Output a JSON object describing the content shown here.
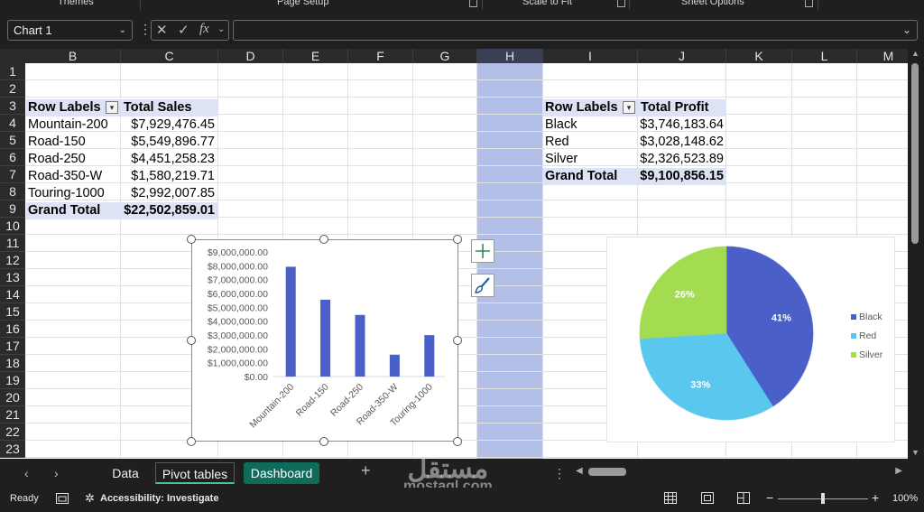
{
  "ribbon_groups": {
    "themes": "Themes",
    "page_setup": "Page Setup",
    "scale_to_fit": "Scale to Fit",
    "sheet_options": "Sheet Options"
  },
  "formula_bar": {
    "name_box": "Chart 1",
    "fx": "fx",
    "cancel": "✕",
    "enter": "✓",
    "formula": ""
  },
  "columns": [
    "B",
    "C",
    "D",
    "E",
    "F",
    "G",
    "H",
    "I",
    "J",
    "K",
    "L",
    "M"
  ],
  "rows": [
    "1",
    "2",
    "3",
    "4",
    "5",
    "6",
    "7",
    "8",
    "9",
    "10",
    "11",
    "12",
    "13",
    "14",
    "15",
    "16",
    "17",
    "18",
    "19",
    "20",
    "21",
    "22",
    "23"
  ],
  "pivot_sales": {
    "header_label": "Row Labels",
    "header_value": "Total Sales",
    "rows": [
      {
        "label": "Mountain-200",
        "value": "$7,929,476.45"
      },
      {
        "label": "Road-150",
        "value": "$5,549,896.77"
      },
      {
        "label": "Road-250",
        "value": "$4,451,258.23"
      },
      {
        "label": "Road-350-W",
        "value": "$1,580,219.71"
      },
      {
        "label": "Touring-1000",
        "value": "$2,992,007.85"
      }
    ],
    "total_label": "Grand Total",
    "total_value": "$22,502,859.01"
  },
  "pivot_profit": {
    "header_label": "Row Labels",
    "header_value": "Total Profit",
    "rows": [
      {
        "label": "Black",
        "value": "$3,746,183.64"
      },
      {
        "label": "Red",
        "value": "$3,028,148.62"
      },
      {
        "label": "Silver",
        "value": "$2,326,523.89"
      }
    ],
    "total_label": "Grand Total",
    "total_value": "$9,100,856.15"
  },
  "chart_data": [
    {
      "type": "bar",
      "categories": [
        "Mountain-200",
        "Road-150",
        "Road-250",
        "Road-350-W",
        "Touring-1000"
      ],
      "values": [
        7929476.45,
        5549896.77,
        4451258.23,
        1580219.71,
        2992007.85
      ],
      "title": "",
      "xlabel": "",
      "ylabel": "",
      "ylim": [
        0,
        9000000
      ],
      "yticks": [
        "$0.00",
        "$1,000,000.00",
        "$2,000,000.00",
        "$3,000,000.00",
        "$4,000,000.00",
        "$5,000,000.00",
        "$6,000,000.00",
        "$7,000,000.00",
        "$8,000,000.00",
        "$9,000,000.00"
      ],
      "grid": false,
      "color": "#4a5fc8"
    },
    {
      "type": "pie",
      "labels": [
        "Black",
        "Red",
        "Silver"
      ],
      "values": [
        41,
        33,
        26
      ],
      "data_labels": [
        "41%",
        "33%",
        "26%"
      ],
      "colors": [
        "#4a5fc8",
        "#5ac8ee",
        "#a3dc50"
      ],
      "legend": "right"
    }
  ],
  "sheet_tabs": [
    "Data",
    "Pivot tables",
    "Dashboard"
  ],
  "status": {
    "ready": "Ready",
    "accessibility": "Accessibility: Investigate",
    "zoom": "100%"
  },
  "watermark": {
    "arabic": "مستقل",
    "latin": "mostaql.com"
  }
}
